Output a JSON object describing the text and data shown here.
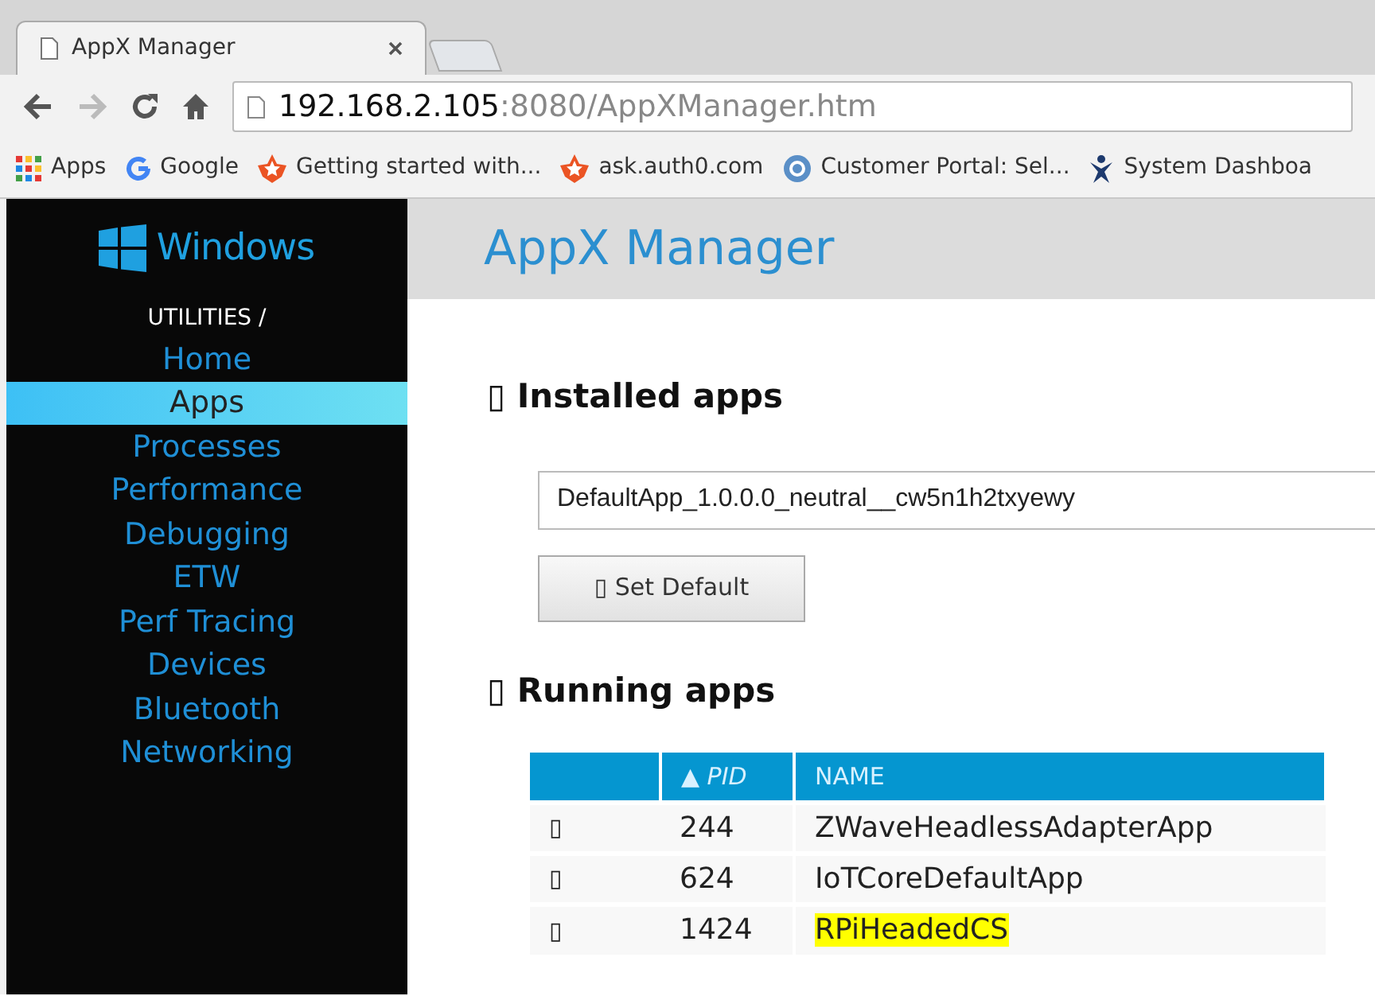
{
  "browser": {
    "tab_title": "AppX Manager",
    "url_host": "192.168.2.105",
    "url_rest": ":8080/AppXManager.htm",
    "bookmarks": [
      {
        "label": "Apps",
        "kind": "apps"
      },
      {
        "label": "Google",
        "kind": "google"
      },
      {
        "label": "Getting started with...",
        "kind": "auth0"
      },
      {
        "label": "ask.auth0.com",
        "kind": "auth0"
      },
      {
        "label": "Customer Portal: Sel...",
        "kind": "cb"
      },
      {
        "label": "System Dashboa",
        "kind": "figure"
      }
    ]
  },
  "sidebar": {
    "logo": "Windows",
    "section": "UTILITIES /",
    "items": [
      {
        "label": "Home",
        "selected": false
      },
      {
        "label": "Apps",
        "selected": true
      },
      {
        "label": "Processes",
        "selected": false
      },
      {
        "label": "Performance",
        "selected": false
      },
      {
        "label": "Debugging",
        "selected": false
      },
      {
        "label": "ETW",
        "selected": false
      },
      {
        "label": "Perf Tracing",
        "selected": false
      },
      {
        "label": "Devices",
        "selected": false
      },
      {
        "label": "Bluetooth",
        "selected": false
      },
      {
        "label": "Networking",
        "selected": false
      }
    ]
  },
  "page_title": "AppX Manager",
  "installed": {
    "heading": "▯ Installed apps",
    "selected_app": "DefaultApp_1.0.0.0_neutral__cw5n1h2txyewy",
    "button": "▯ Set Default"
  },
  "running": {
    "heading": "▯ Running apps",
    "table": {
      "columns": [
        "",
        "▲ PID",
        "NAME"
      ],
      "rows": [
        {
          "action": "▯",
          "pid": "244",
          "name": "ZWaveHeadlessAdapterApp",
          "highlighted": false
        },
        {
          "action": "▯",
          "pid": "624",
          "name": "IoTCoreDefaultApp",
          "highlighted": false
        },
        {
          "action": "▯",
          "pid": "1424",
          "name": "RPiHeadedCS",
          "highlighted": true
        }
      ]
    }
  }
}
